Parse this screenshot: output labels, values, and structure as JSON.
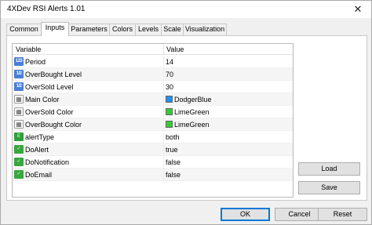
{
  "window": {
    "title": "4XDev RSI Alerts 1.01",
    "close_glyph": "✕"
  },
  "tabs": [
    {
      "label": "Common"
    },
    {
      "label": "Inputs",
      "active": true
    },
    {
      "label": "Parameters"
    },
    {
      "label": "Colors"
    },
    {
      "label": "Levels"
    },
    {
      "label": "Scale"
    },
    {
      "label": "Visualization"
    }
  ],
  "grid": {
    "columns": [
      "Variable",
      "Value"
    ],
    "rows": [
      {
        "icon": "numeric-icon",
        "icon_text": "123",
        "name": "Period",
        "value": "14"
      },
      {
        "icon": "numeric-icon",
        "icon_text": "1/2",
        "name": "OverBought Level",
        "value": "70"
      },
      {
        "icon": "numeric-icon",
        "icon_text": "1/2",
        "name": "OverSold Level",
        "value": "30"
      },
      {
        "icon": "color-icon",
        "icon_text": "▦",
        "name": "Main Color",
        "value": "DodgerBlue",
        "swatch": "#1e90ff"
      },
      {
        "icon": "color-icon",
        "icon_text": "▦",
        "name": "OverSold Color",
        "value": "LimeGreen",
        "swatch": "#32cd32"
      },
      {
        "icon": "color-icon",
        "icon_text": "▦",
        "name": "OverBought Color",
        "value": "LimeGreen",
        "swatch": "#32cd32"
      },
      {
        "icon": "enum-icon",
        "icon_text": "E",
        "name": "alertType",
        "value": "both"
      },
      {
        "icon": "bool-icon",
        "icon_text": "✓",
        "name": "DoAlert",
        "value": "true"
      },
      {
        "icon": "bool-icon",
        "icon_text": "✓",
        "name": "DoNotification",
        "value": "false"
      },
      {
        "icon": "bool-icon",
        "icon_text": "✓",
        "name": "DoEmail",
        "value": "false"
      }
    ]
  },
  "side_buttons": {
    "load": "Load",
    "save": "Save"
  },
  "footer_buttons": {
    "ok": "OK",
    "cancel": "Cancel",
    "reset": "Reset"
  },
  "colors": {
    "accent": "#0078d7"
  }
}
